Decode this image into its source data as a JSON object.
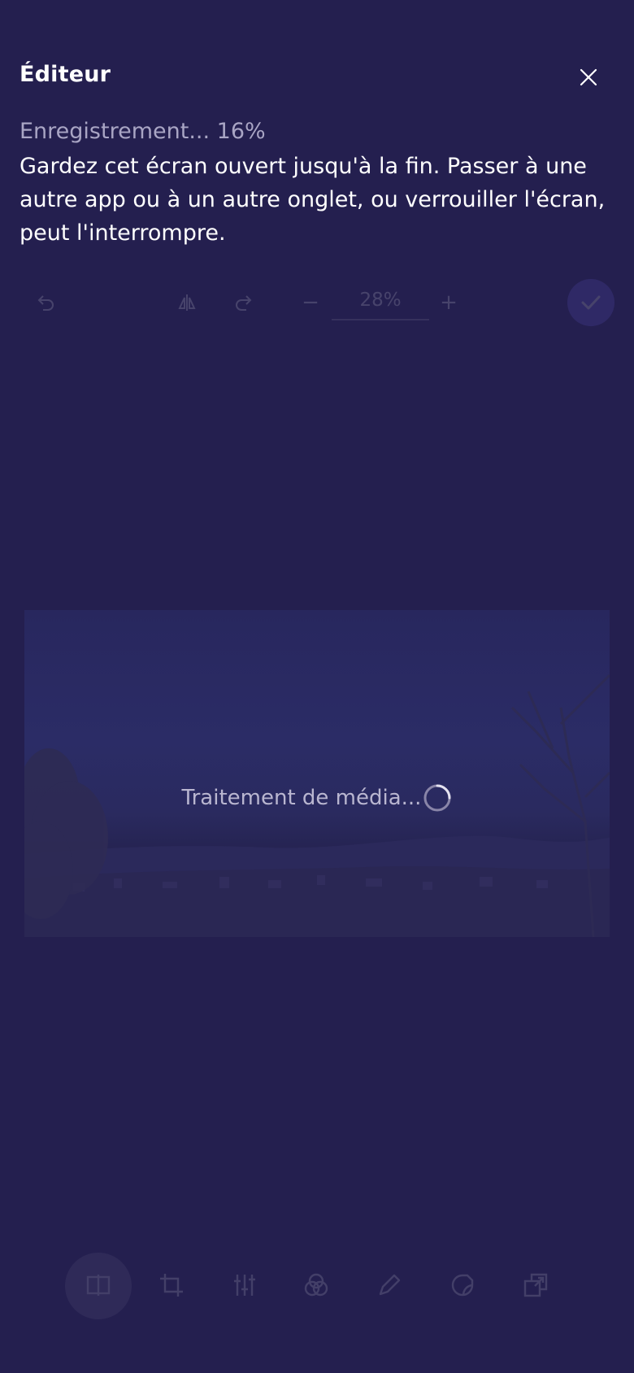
{
  "header": {
    "title": "Éditeur",
    "close_icon": "close-icon"
  },
  "export": {
    "status": "Enregistrement... 16%",
    "progress_percent": 16,
    "message": "Gardez cet écran ouvert jusqu'à la fin. Passer à une autre app ou à un autre onglet, ou verrouiller l'écran, peut l'interrompre."
  },
  "toolbar": {
    "zoom_minus": "−",
    "zoom_value": "28%",
    "zoom_plus": "+",
    "confirm_icon": "check-icon",
    "icons": [
      "undo-icon",
      "flip-icon",
      "redo-icon"
    ]
  },
  "media": {
    "processing_label": "Traitement de média...",
    "spinner_icon": "spinner-icon"
  },
  "bottom_toolbar": {
    "tools": [
      {
        "name": "canvas-tool",
        "icon": "canvas-icon",
        "active": true
      },
      {
        "name": "crop-tool",
        "icon": "crop-icon"
      },
      {
        "name": "adjust-tool",
        "icon": "sliders-icon"
      },
      {
        "name": "filter-tool",
        "icon": "filter-icon"
      },
      {
        "name": "draw-tool",
        "icon": "pencil-icon"
      },
      {
        "name": "sticker-tool",
        "icon": "sticker-icon"
      },
      {
        "name": "overlay-tool",
        "icon": "overlay-icon"
      }
    ]
  },
  "colors": {
    "background": "#241f4f",
    "accent": "#6a5fe0",
    "text_primary": "#ffffff",
    "text_secondary": "#a9a5c4"
  }
}
